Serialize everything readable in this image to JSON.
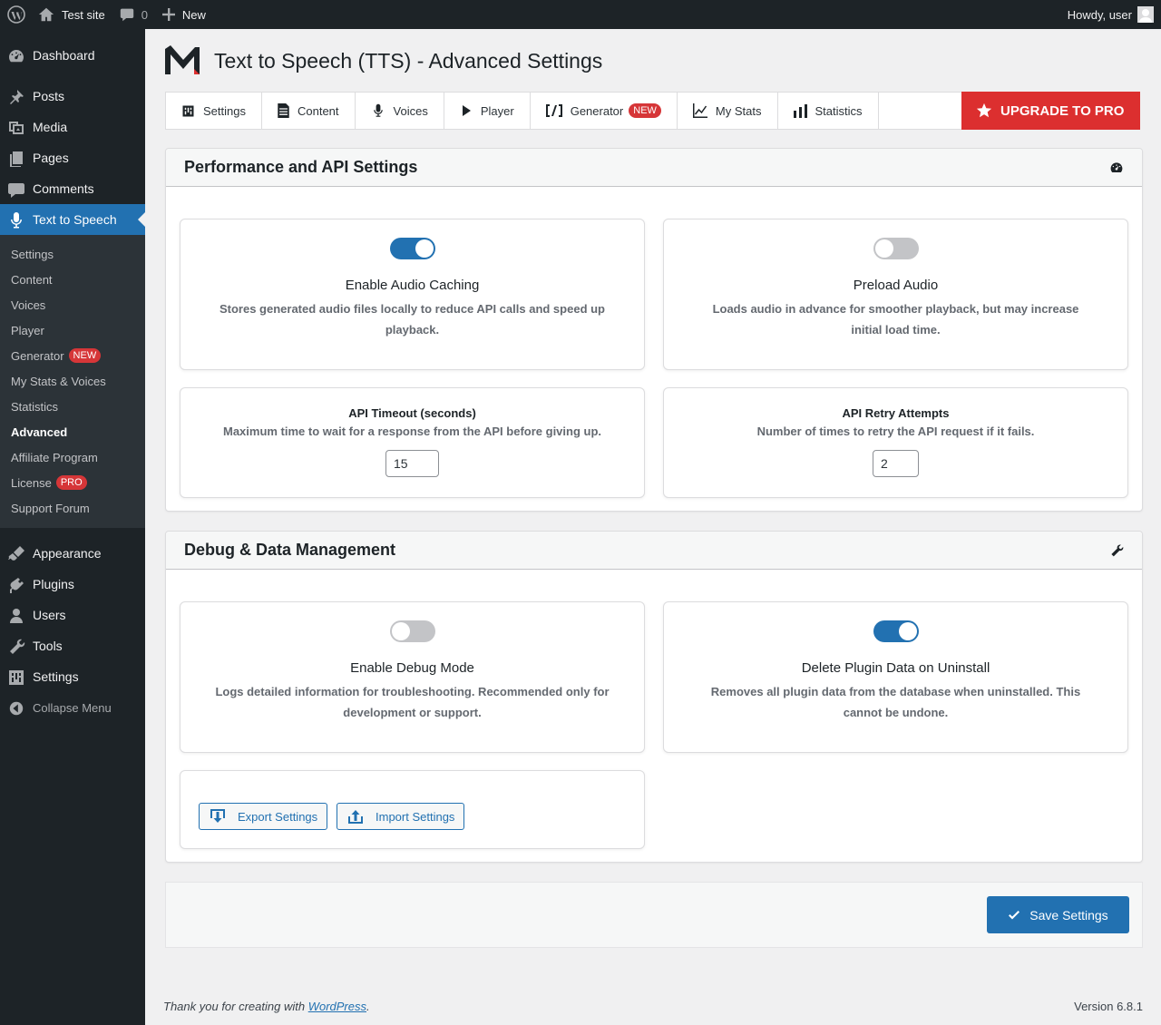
{
  "adminbar": {
    "site_name": "Test site",
    "comments_count": "0",
    "new_label": "New",
    "howdy": "Howdy, user"
  },
  "sidebar": {
    "items_top": [
      {
        "label": "Dashboard",
        "icon": "dashboard-icon"
      },
      {
        "label": "Posts",
        "icon": "pin-icon"
      },
      {
        "label": "Media",
        "icon": "media-icon"
      },
      {
        "label": "Pages",
        "icon": "pages-icon"
      },
      {
        "label": "Comments",
        "icon": "comment-icon"
      },
      {
        "label": "Text to Speech",
        "icon": "microphone-icon",
        "current": true
      }
    ],
    "submenu": [
      {
        "label": "Settings"
      },
      {
        "label": "Content"
      },
      {
        "label": "Voices"
      },
      {
        "label": "Player"
      },
      {
        "label": "Generator",
        "badge": "NEW"
      },
      {
        "label": "My Stats & Voices"
      },
      {
        "label": "Statistics"
      },
      {
        "label": "Advanced",
        "active": true
      },
      {
        "label": "Affiliate Program"
      },
      {
        "label": "License",
        "badge": "PRO"
      },
      {
        "label": "Support Forum"
      }
    ],
    "items_bottom": [
      {
        "label": "Appearance",
        "icon": "brush-icon"
      },
      {
        "label": "Plugins",
        "icon": "plugin-icon"
      },
      {
        "label": "Users",
        "icon": "users-icon"
      },
      {
        "label": "Tools",
        "icon": "wrench-icon"
      },
      {
        "label": "Settings",
        "icon": "settings-icon"
      }
    ],
    "collapse_label": "Collapse Menu"
  },
  "page": {
    "title": "Text to Speech (TTS) - Advanced Settings"
  },
  "tabs": [
    {
      "label": "Settings",
      "icon": "settings-icon"
    },
    {
      "label": "Content",
      "icon": "document-icon"
    },
    {
      "label": "Voices",
      "icon": "microphone-icon"
    },
    {
      "label": "Player",
      "icon": "play-icon"
    },
    {
      "label": "Generator",
      "icon": "code-icon",
      "badge": "NEW"
    },
    {
      "label": "My Stats",
      "icon": "chart-line-icon"
    },
    {
      "label": "Statistics",
      "icon": "chart-bar-icon"
    }
  ],
  "upgrade_label": "UPGRADE TO PRO",
  "performance": {
    "title": "Performance and API Settings",
    "caching": {
      "title": "Enable Audio Caching",
      "desc": "Stores generated audio files locally to reduce API calls and speed up playback.",
      "enabled": true
    },
    "preload": {
      "title": "Preload Audio",
      "desc": "Loads audio in advance for smoother playback, but may increase initial load time.",
      "enabled": false
    },
    "timeout": {
      "title": "API Timeout (seconds)",
      "desc": "Maximum time to wait for a response from the API before giving up.",
      "value": "15"
    },
    "retry": {
      "title": "API Retry Attempts",
      "desc": "Number of times to retry the API request if it fails.",
      "value": "2"
    }
  },
  "debug": {
    "title": "Debug & Data Management",
    "debug_mode": {
      "title": "Enable Debug Mode",
      "desc": "Logs detailed information for troubleshooting. Recommended only for development or support.",
      "enabled": false
    },
    "delete_data": {
      "title": "Delete Plugin Data on Uninstall",
      "desc": "Removes all plugin data from the database when uninstalled. This cannot be undone.",
      "enabled": true
    },
    "export_label": "Export Settings",
    "import_label": "Import Settings"
  },
  "save_label": "Save Settings",
  "footer": {
    "thanks_prefix": "Thank you for creating with ",
    "wordpress_link": "WordPress",
    "thanks_suffix": ".",
    "version": "Version 6.8.1"
  },
  "colors": {
    "accent": "#2271b1",
    "upgrade": "#dc2f2f",
    "badge": "#d63638",
    "sidebar": "#1d2327"
  }
}
